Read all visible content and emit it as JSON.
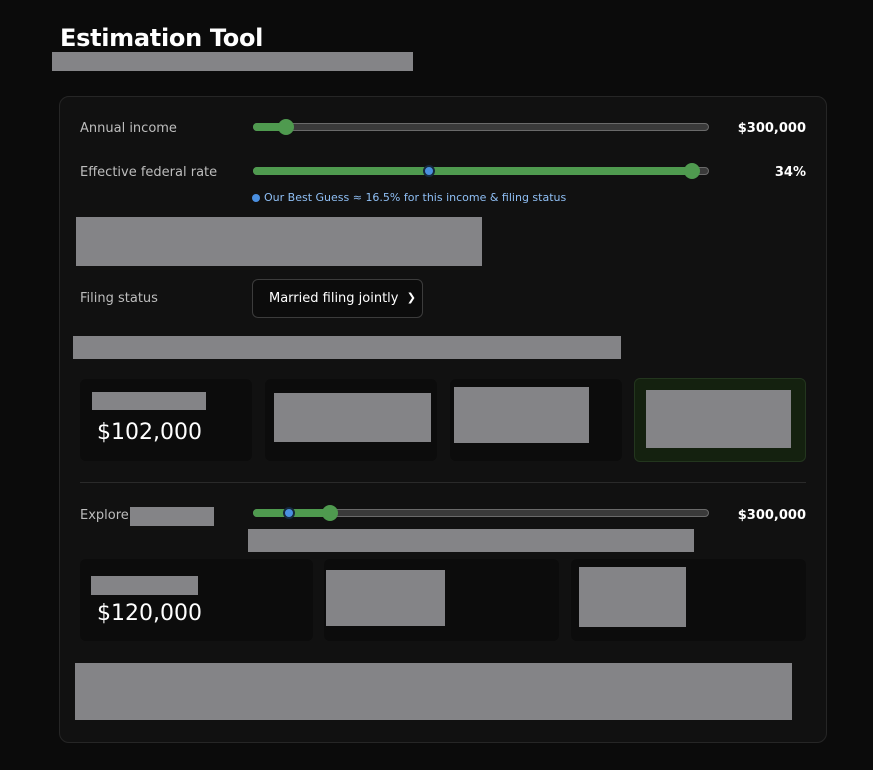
{
  "header": {
    "title": "Estimation Tool"
  },
  "income": {
    "label": "Annual income",
    "value": "$300,000",
    "slider_fraction": 0.06
  },
  "rate": {
    "label": "Effective federal rate",
    "value": "34%",
    "slider_fraction": 0.95,
    "guess_fraction": 0.385,
    "hint": "Our Best Guess ≈ 16.5% for this income & filing status"
  },
  "filing": {
    "label": "Filing status",
    "selected": "Married filing jointly"
  },
  "results": {
    "first_value": "$102,000"
  },
  "explore": {
    "label": "Explore:",
    "value": "$300,000",
    "slider_fraction": 0.155,
    "marker_fraction": 0.08,
    "first_value": "$120,000"
  },
  "colors": {
    "accent_green": "#4f9a4f",
    "marker_blue": "#4a8fe0",
    "hint_blue": "#8fbff5",
    "redaction_gray": "#848487"
  }
}
